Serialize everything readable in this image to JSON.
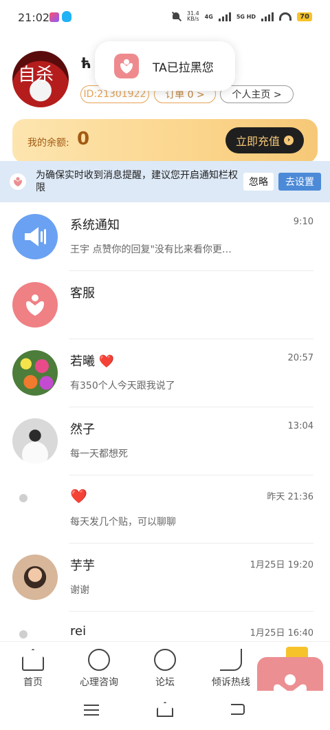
{
  "status_bar": {
    "time": "21:02",
    "net_speed_value": "31.4",
    "net_speed_unit": "KB/s",
    "net1": "4G",
    "net2": "5G HD",
    "battery": "70"
  },
  "profile": {
    "avatar_text": "自杀",
    "username": "ћ",
    "id": "ID:21301922",
    "order": "订单 0 >",
    "home": "个人主页 >"
  },
  "toast": {
    "text": "TA已拉黑您"
  },
  "balance": {
    "label": "我的余额:",
    "value": "0",
    "recharge": "立即充值"
  },
  "notice": {
    "text": "为确保实时收到消息提醒，建议您开启通知栏权限",
    "ignore": "忽略",
    "settings": "去设置"
  },
  "messages": [
    {
      "name": "系统通知",
      "time": "9:10",
      "text": "王宇 点赞你的回复\"没有比来看你更…"
    },
    {
      "name": "客服",
      "time": "",
      "text": ""
    },
    {
      "name": "若曦 ❤️",
      "time": "20:57",
      "text": "有350个人今天跟我说了"
    },
    {
      "name": "然子",
      "time": "13:04",
      "text": "每一天都想死"
    },
    {
      "name": "❤️",
      "time": "昨天 21:36",
      "text": "每天发几个贴，可以聊聊"
    },
    {
      "name": "芋芋",
      "time": "1月25日 19:20",
      "text": "谢谢"
    },
    {
      "name": "rei",
      "time": "1月25日 16:40",
      "text": ""
    }
  ],
  "bottom_nav": [
    {
      "label": "首页",
      "icon": "home-icon"
    },
    {
      "label": "心理咨询",
      "icon": "heart-person-icon"
    },
    {
      "label": "论坛",
      "icon": "forum-icon"
    },
    {
      "label": "倾诉热线",
      "icon": "phone-icon"
    }
  ],
  "colors": {
    "accent_blue": "#4c8ad8",
    "brand_pink": "#ec8f92",
    "balance_gold": "#f6c877",
    "balance_text": "#a25a14"
  }
}
